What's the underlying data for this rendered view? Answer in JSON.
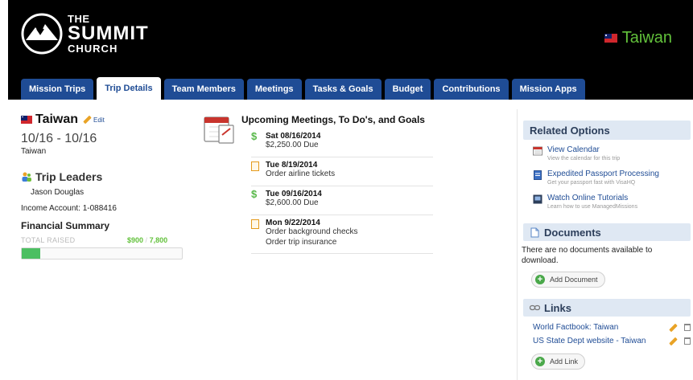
{
  "header": {
    "logo": {
      "line1": "THE",
      "line2": "SUMMIT",
      "line3": "CHURCH"
    },
    "country": "Taiwan"
  },
  "tabs": [
    {
      "label": "Mission Trips",
      "active": false
    },
    {
      "label": "Trip Details",
      "active": true
    },
    {
      "label": "Team Members",
      "active": false
    },
    {
      "label": "Meetings",
      "active": false
    },
    {
      "label": "Tasks & Goals",
      "active": false
    },
    {
      "label": "Budget",
      "active": false
    },
    {
      "label": "Contributions",
      "active": false
    },
    {
      "label": "Mission Apps",
      "active": false
    }
  ],
  "trip": {
    "name": "Taiwan",
    "edit_label": "Edit",
    "dates": "10/16 - 10/16",
    "destination": "Taiwan",
    "leaders_title": "Trip Leaders",
    "leader": "Jason Douglas",
    "income_account": "Income Account: 1-088416"
  },
  "financial": {
    "title": "Financial Summary",
    "total_raised_label": "TOTAL RAISED",
    "raised": "$900",
    "separator": "/",
    "goal": "7,800",
    "progress_fraction": 0.115
  },
  "meetings": {
    "title": "Upcoming Meetings, To Do's, and Goals",
    "items": [
      {
        "icon": "dollar-icon",
        "date": "Sat 08/16/2014",
        "lines": [
          "$2,250.00 Due"
        ]
      },
      {
        "icon": "task-icon",
        "date": "Tue 8/19/2014",
        "lines": [
          "Order airline tickets"
        ]
      },
      {
        "icon": "dollar-icon",
        "date": "Tue 09/16/2014",
        "lines": [
          "$2,600.00 Due"
        ]
      },
      {
        "icon": "task-icon",
        "date": "Mon 9/22/2014",
        "lines": [
          "Order background checks",
          "Order trip insurance"
        ]
      }
    ]
  },
  "related": {
    "title": "Related Options",
    "items": [
      {
        "title": "View Calendar",
        "sub": "View the calendar for this trip"
      },
      {
        "title": "Expedited Passport Processing",
        "sub": "Get your passport fast with VisaHQ"
      },
      {
        "title": "Watch Online Tutorials",
        "sub": "Learn how to use ManagedMissions"
      }
    ]
  },
  "documents": {
    "title": "Documents",
    "empty_text": "There are no documents available to download.",
    "add_label": "Add Document"
  },
  "links": {
    "title": "Links",
    "items": [
      {
        "label": "World Factbook: Taiwan"
      },
      {
        "label": "US State Dept website - Taiwan"
      }
    ],
    "add_label": "Add Link"
  },
  "colors": {
    "tab_blue": "#1f4c95",
    "accent_green": "#62c13b",
    "panel_blue": "#dfe8f3",
    "progress_green": "#4cbf62"
  }
}
